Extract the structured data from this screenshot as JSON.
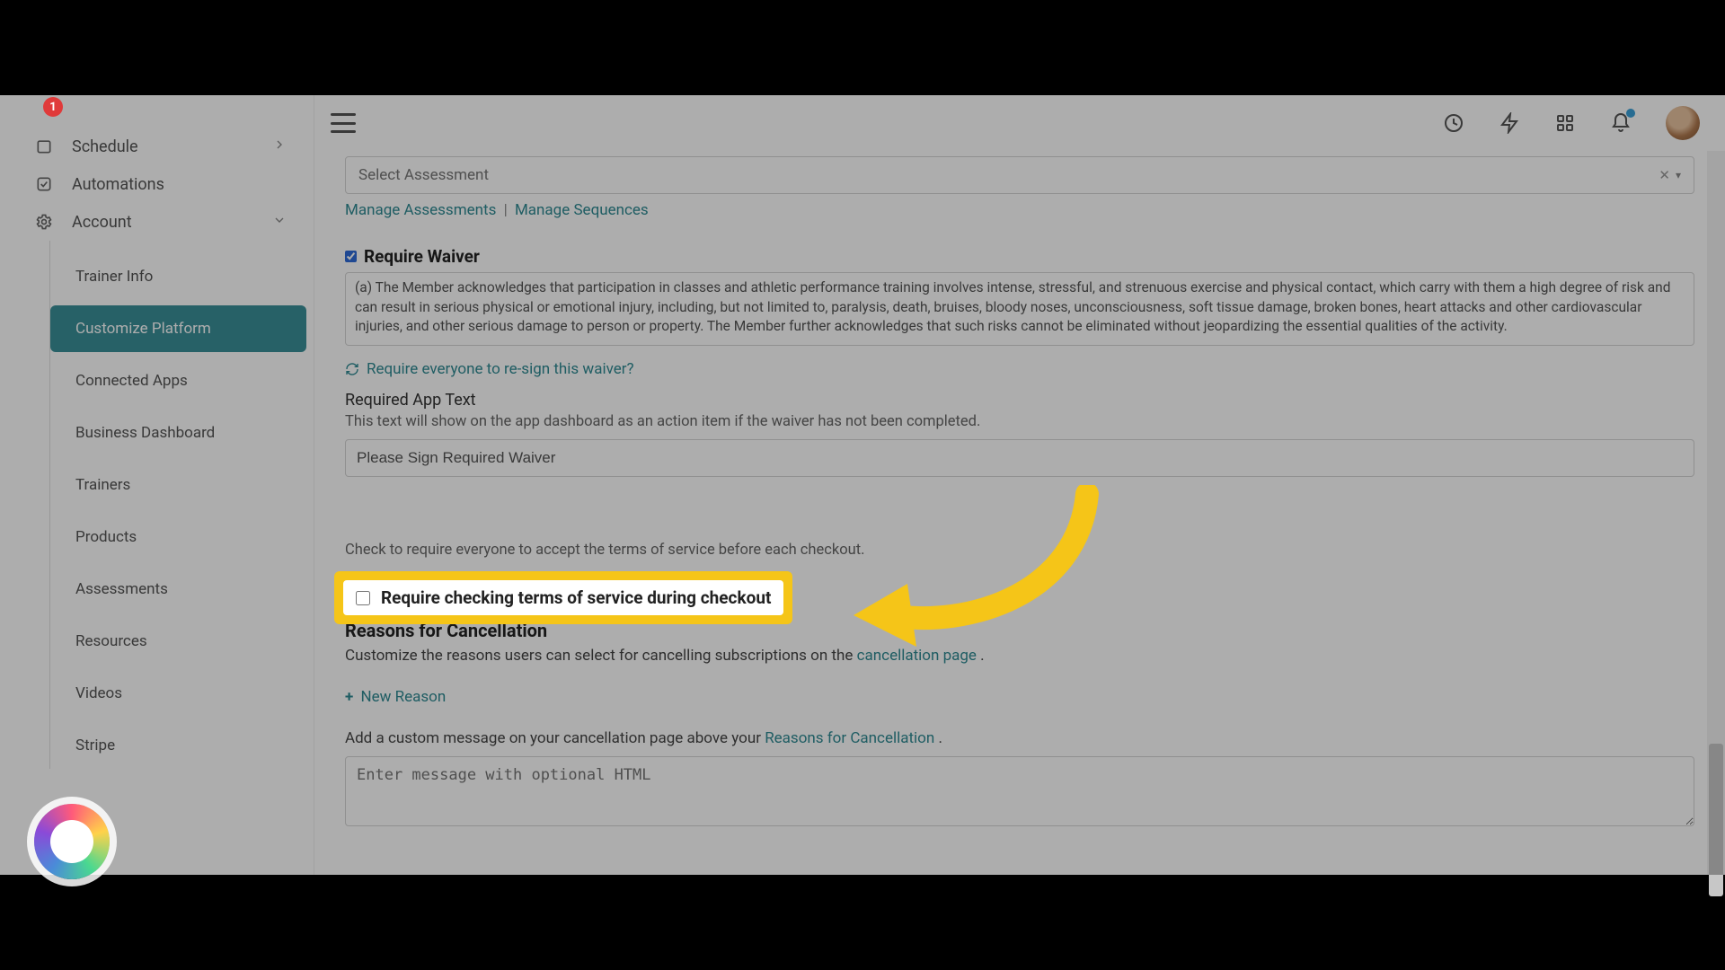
{
  "sidebar": {
    "items": [
      {
        "label": "Schedule",
        "icon": "calendar"
      },
      {
        "label": "Automations",
        "icon": "check"
      },
      {
        "label": "Account",
        "icon": "gear"
      }
    ],
    "account_sub": [
      "Trainer Info",
      "Customize Platform",
      "Connected Apps",
      "Business Dashboard",
      "Trainers",
      "Products",
      "Assessments",
      "Resources",
      "Videos",
      "Stripe"
    ],
    "widget_badge": "1"
  },
  "assessment": {
    "placeholder": "Select Assessment",
    "manage_assessments": "Manage Assessments",
    "manage_sequences": "Manage Sequences"
  },
  "waiver": {
    "require_label": "Require Waiver",
    "body": "(a)    The Member acknowledges that participation in classes and athletic performance training involves intense, stressful, and strenuous exercise and physical contact, which carry with them a high degree of risk and can result in serious physical or emotional injury, including, but not limited to, paralysis, death, bruises, bloody noses, unconsciousness, soft tissue damage, broken bones, heart attacks and other cardiovascular injuries, and other serious damage to person or property. The Member further acknowledges that such risks cannot be eliminated without jeopardizing the essential qualities of the activity.",
    "resign_link": "Require everyone to re-sign this waiver?",
    "app_text_label": "Required App Text",
    "app_text_help": "This text will show on the app dashboard as an action item if the waiver has not been completed.",
    "app_text_value": "Please Sign Required Waiver"
  },
  "tos": {
    "label": "Require checking terms of service during checkout",
    "help": "Check to require everyone to accept the terms of service before each checkout."
  },
  "cancel": {
    "heading": "Reasons for Cancellation",
    "help_pre": "Customize the reasons users can select for cancelling subscriptions on the ",
    "link": "cancellation page",
    "help_post": " .",
    "new_reason": "New Reason",
    "msg_help_pre": "Add a custom message on your cancellation page above your ",
    "msg_link": "Reasons for Cancellation",
    "msg_help_post": " .",
    "textarea_placeholder": "Enter message with optional HTML"
  }
}
